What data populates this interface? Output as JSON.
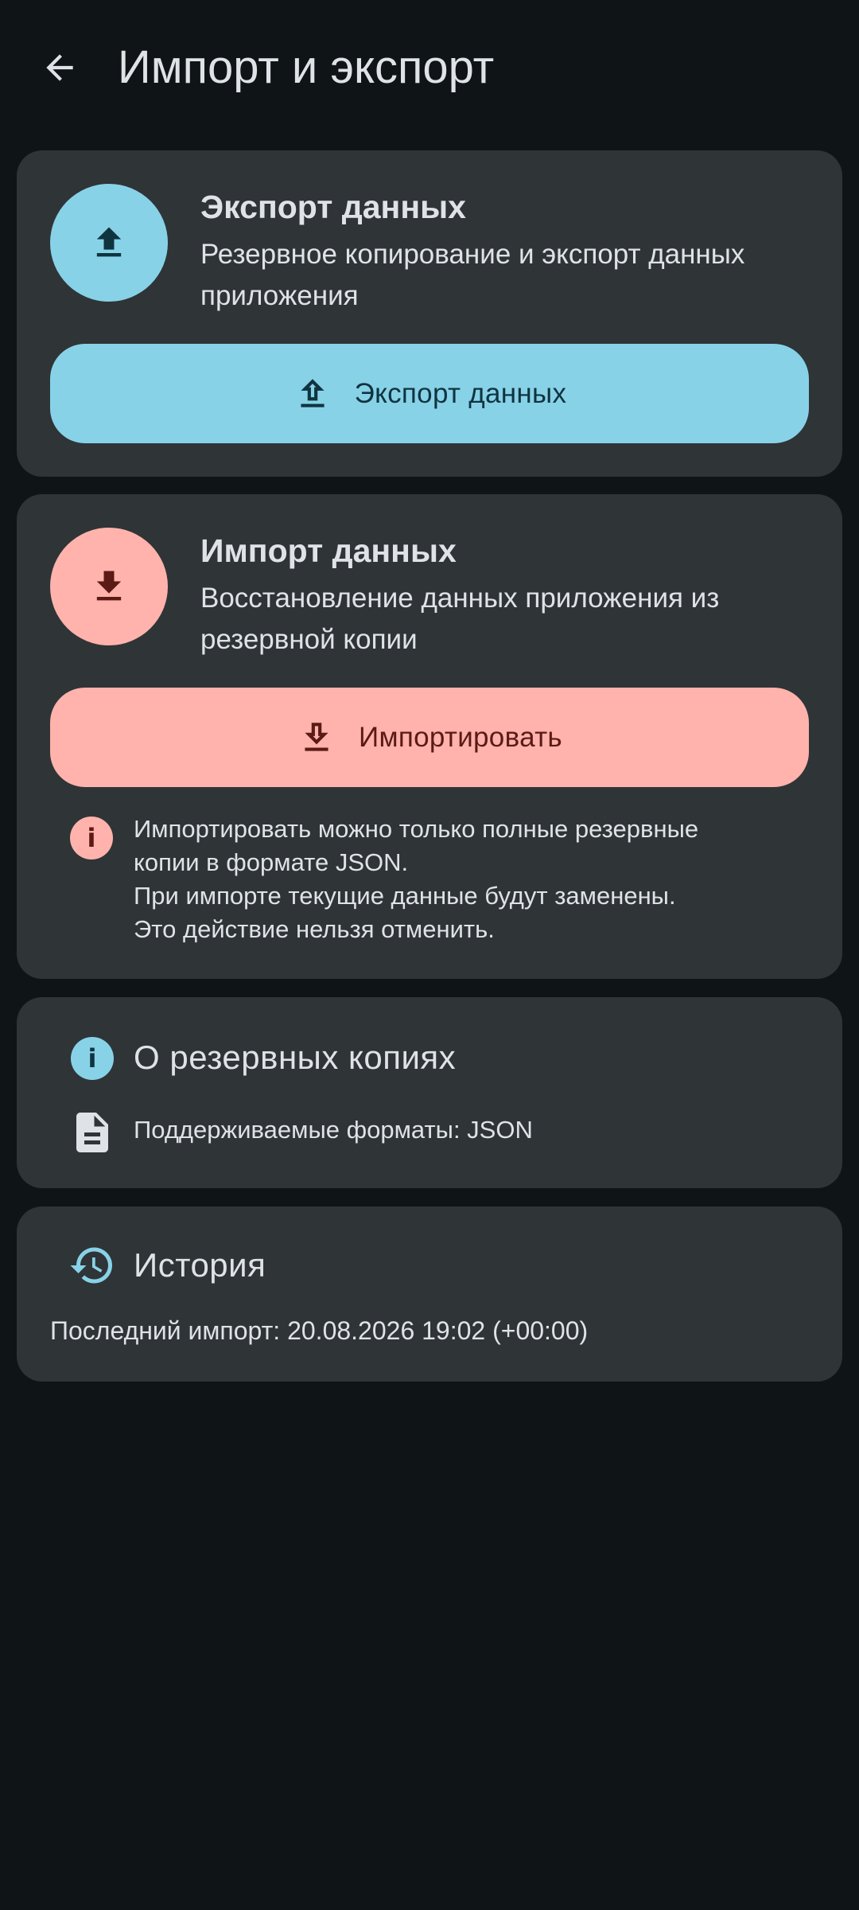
{
  "header": {
    "title": "Импорт и экспорт",
    "back_icon": "arrow-back-icon"
  },
  "export_card": {
    "title": "Экспорт данных",
    "description": "Резервное копирование и экспорт данных приложения",
    "button_label": "Экспорт данных",
    "icon": "upload-icon",
    "accent_color": "#88d2e8"
  },
  "import_card": {
    "title": "Импорт данных",
    "description": "Восстановление данных приложения из резервной копии",
    "button_label": "Импортировать",
    "icon": "download-icon",
    "accent_color": "#ffb3ac",
    "warning": {
      "icon": "info-icon",
      "lines": [
        "Импортировать можно только полные резервные",
        "копии в формате JSON.",
        "При импорте текущие данные будут заменены.",
        "Это действие нельзя отменить."
      ]
    }
  },
  "about_card": {
    "title": "О резервных копиях",
    "icon": "info-icon",
    "formats_icon": "file-document-icon",
    "formats_text": "Поддерживаемые форматы: JSON"
  },
  "history_card": {
    "title": "История",
    "icon": "history-icon",
    "last_import": "Последний импорт: 20.08.2026 19:02 (+00:00)"
  },
  "colors": {
    "background": "#0f1417",
    "card": "#2f3437",
    "text": "#dfe3e7"
  }
}
